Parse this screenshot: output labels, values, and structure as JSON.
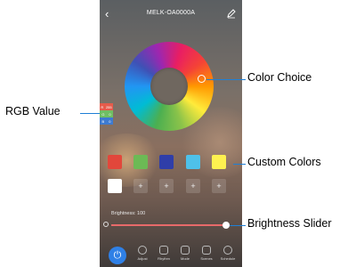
{
  "app": {
    "title": "MELK-OA0000A",
    "back_icon": "chevron-left-icon",
    "edit_icon": "pencil-icon"
  },
  "rgb": {
    "rows": [
      {
        "label": "R",
        "value": "255"
      },
      {
        "label": "G",
        "value": "0"
      },
      {
        "label": "B",
        "value": "0"
      }
    ]
  },
  "custom_colors": {
    "row1": [
      "#e2473b",
      "#6cba55",
      "#2f3ea9",
      "#4ec1ea",
      "#fef150"
    ],
    "row2_first": "#ffffff",
    "plus_label": "+"
  },
  "brightness": {
    "label": "Brightness: 100",
    "level": 1.0
  },
  "bottom_nav": {
    "power_icon": "power-icon",
    "items": [
      {
        "label": "Adjust"
      },
      {
        "label": "Rhythm"
      },
      {
        "label": "Mode"
      },
      {
        "label": "Scenes"
      },
      {
        "label": "Schedule"
      }
    ]
  },
  "callouts": {
    "color_choice": "Color Choice",
    "rgb_value": "RGB Value",
    "custom_colors": "Custom Colors",
    "brightness_slider": "Brightness Slider"
  },
  "accent": "#1e7fd6"
}
